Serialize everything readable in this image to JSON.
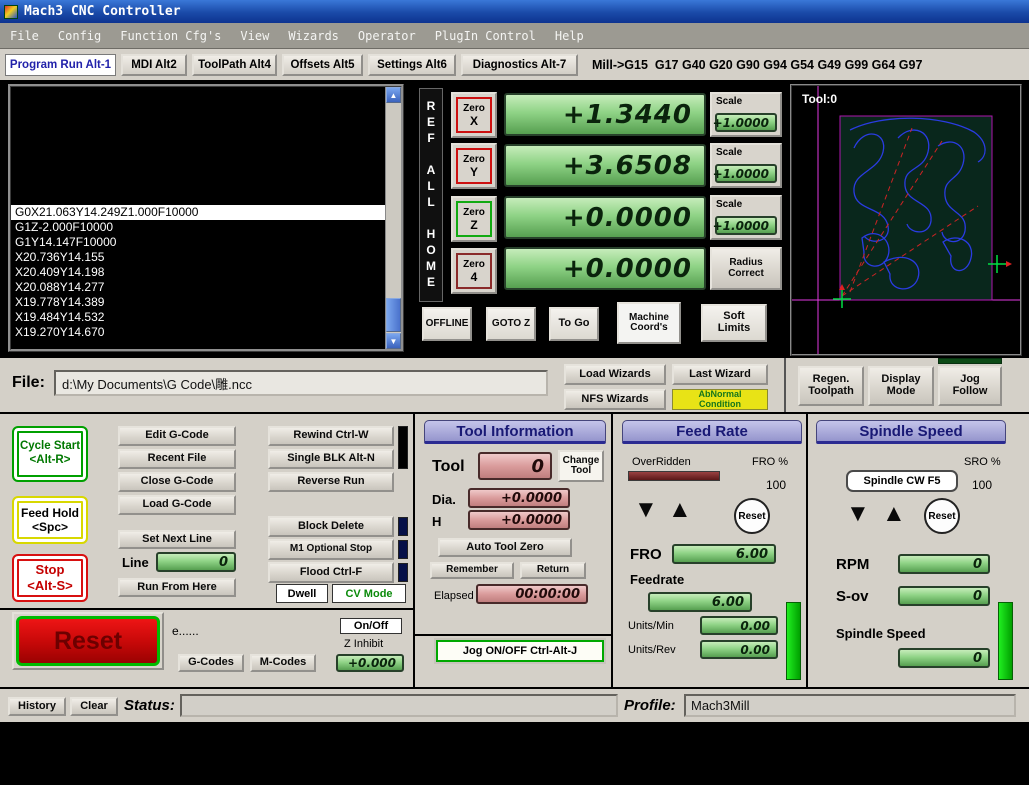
{
  "window": {
    "title": "Mach3 CNC Controller"
  },
  "menu": {
    "items": [
      "File",
      "Config",
      "Function Cfg's",
      "View",
      "Wizards",
      "Operator",
      "PlugIn Control",
      "Help"
    ]
  },
  "icons": {
    "up_arrow": "▲",
    "down_arrow": "▼",
    "scroll_up": "▲",
    "scroll_down": "▼"
  },
  "tabs": {
    "program_run": "Program Run Alt-1",
    "mdi": "MDI Alt2",
    "toolpath": "ToolPath Alt4",
    "offsets": "Offsets Alt5",
    "settings": "Settings Alt6",
    "diagnostics": "Diagnostics Alt-7",
    "modal_status": "Mill->G15  G17 G40 G20 G90 G94 G54 G49 G99 G64 G97"
  },
  "gcode_panel": {
    "lines": [
      "G0X21.063Y14.249Z1.000F10000",
      "G1Z-2.000F10000",
      "G1Y14.147F10000",
      "X20.736Y14.155",
      "X20.409Y14.198",
      "X20.088Y14.277",
      "X19.778Y14.389",
      "X19.484Y14.532",
      "X19.270Y14.670"
    ]
  },
  "dro": {
    "ref_all_home": "REF ALL HOME",
    "zero_x_1": "Zero",
    "zero_x_2": "X",
    "zero_y_1": "Zero",
    "zero_y_2": "Y",
    "zero_z_1": "Zero",
    "zero_z_2": "Z",
    "zero_4_1": "Zero",
    "zero_4_2": "4",
    "x_value": "+1.3440",
    "y_value": "+3.6508",
    "z_value": "+0.0000",
    "a_value": "+0.0000",
    "scale_label": "Scale",
    "scale_x": "+1.0000",
    "scale_y": "+1.0000",
    "scale_z": "+1.0000",
    "radius_correct_1": "Radius",
    "radius_correct_2": "Correct",
    "offline": "OFFLINE",
    "goto_z": "GOTO Z",
    "to_go": "To Go",
    "machine_coords_1": "Machine",
    "machine_coords_2": "Coord's",
    "soft_limits_1": "Soft",
    "soft_limits_2": "Limits"
  },
  "toolpath": {
    "tool_label": "Tool:0",
    "glyph": "雕"
  },
  "file_bar": {
    "label": "File:",
    "path": "d:\\My Documents\\G Code\\雕.ncc",
    "load_wizards": "Load Wizards",
    "last_wizard": "Last Wizard",
    "nfs_wizards": "NFS Wizards",
    "abnormal_1": "AbNormal",
    "abnormal_2": "Condition",
    "regen_1": "Regen.",
    "regen_2": "Toolpath",
    "display_1": "Display",
    "display_2": "Mode",
    "jog_1": "Jog",
    "jog_2": "Follow"
  },
  "run_controls": {
    "cycle_start_1": "Cycle Start",
    "cycle_start_2": "<Alt-R>",
    "feed_hold_1": "Feed Hold",
    "feed_hold_2": "<Spc>",
    "stop_1": "Stop",
    "stop_2": "<Alt-S>",
    "edit_gcode": "Edit G-Code",
    "recent_file": "Recent File",
    "close_gcode": "Close G-Code",
    "load_gcode": "Load G-Code",
    "set_next_line": "Set Next Line",
    "line_label": "Line",
    "line_value": "0",
    "run_from_here": "Run From Here",
    "rewind": "Rewind Ctrl-W",
    "single_blk": "Single BLK Alt-N",
    "reverse_run": "Reverse Run",
    "block_delete": "Block Delete",
    "m1_optional_stop": "M1 Optional Stop",
    "flood": "Flood Ctrl-F",
    "dwell": "Dwell",
    "cv_mode": "CV Mode",
    "reset": "Reset",
    "dots": "e......",
    "gcodes": "G-Codes",
    "mcodes": "M-Codes",
    "on_off": "On/Off",
    "z_inhibit_label": "Z Inhibit",
    "z_inhibit_value": "+0.000"
  },
  "tool_info": {
    "title": "Tool Information",
    "tool_label": "Tool",
    "tool_value": "0",
    "change_1": "Change",
    "change_2": "Tool",
    "dia_label": "Dia.",
    "dia_value": "+0.0000",
    "h_label": "H",
    "h_value": "+0.0000",
    "auto_tool_zero": "Auto Tool Zero",
    "remember": "Remember",
    "return_btn": "Return",
    "elapsed_label": "Elapsed",
    "elapsed_value": "00:00:00",
    "jog_onoff": "Jog ON/OFF Ctrl-Alt-J"
  },
  "feed_rate": {
    "title": "Feed Rate",
    "overridden": "OverRidden",
    "fro_pct_label": "FRO %",
    "fro_pct_value": "100",
    "reset": "Reset",
    "fro_label": "FRO",
    "fro_value": "6.00",
    "feedrate_label": "Feedrate",
    "feedrate_value": "6.00",
    "units_min_label": "Units/Min",
    "units_min_value": "0.00",
    "units_rev_label": "Units/Rev",
    "units_rev_value": "0.00"
  },
  "spindle": {
    "title": "Spindle Speed",
    "spindle_cw": "Spindle CW F5",
    "sro_pct_label": "SRO %",
    "sro_pct_value": "100",
    "reset": "Reset",
    "rpm_label": "RPM",
    "rpm_value": "0",
    "sov_label": "S-ov",
    "sov_value": "0",
    "spindle_label": "Spindle Speed",
    "spindle_value": "0"
  },
  "status_bar": {
    "history": "History",
    "clear": "Clear",
    "status_label": "Status:",
    "status_value": "",
    "profile_label": "Profile:",
    "profile_value": "Mach3Mill"
  }
}
